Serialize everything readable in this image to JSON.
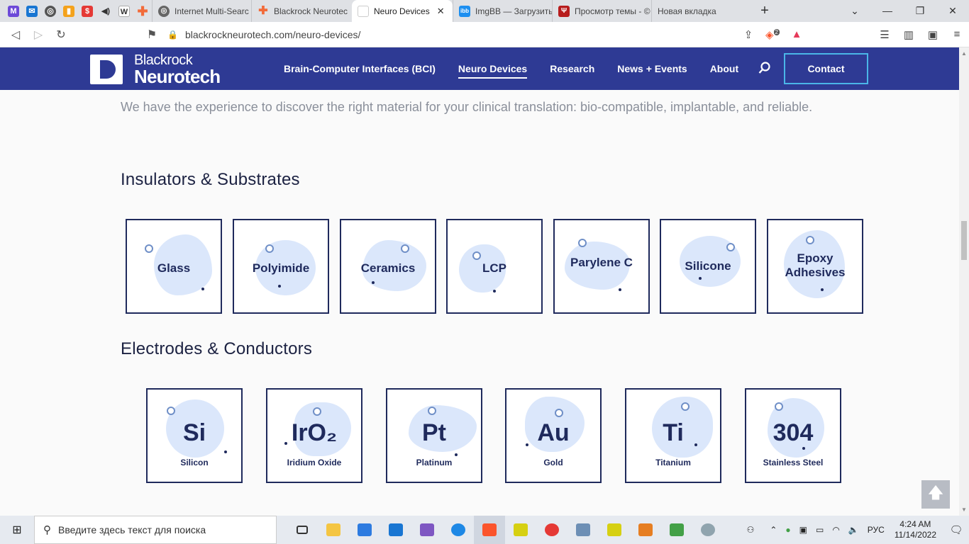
{
  "browser": {
    "pinned_tabs": [
      {
        "icon": "mail-icon",
        "color": "#6d4ad8"
      },
      {
        "icon": "mail-outlook-icon",
        "color": "#1976d2"
      },
      {
        "icon": "globe-icon",
        "color": "#555555"
      },
      {
        "icon": "analytics-icon",
        "color": "#f4a21c"
      },
      {
        "icon": "bank-icon",
        "color": "#e53935"
      },
      {
        "icon": "speaker-icon",
        "color": "#333333"
      },
      {
        "icon": "wikipedia-icon",
        "color": "#333333",
        "glyph": "W"
      },
      {
        "icon": "plus-red-icon",
        "color": "#f26b3a"
      }
    ],
    "tabs": [
      {
        "title": "Internet Multi-Searc",
        "active": false
      },
      {
        "title": "Blackrock Neurotec",
        "active": false
      },
      {
        "title": "Neuro Devices",
        "active": true
      },
      {
        "title": "ImgBB — Загрузить",
        "active": false
      },
      {
        "title": "Просмотр темы - ©",
        "active": false
      },
      {
        "title": "Новая вкладка",
        "active": false
      }
    ],
    "url": "blackrockneurotech.com/neuro-devices/",
    "brave_badge": "2"
  },
  "site": {
    "logo_line1": "Blackrock",
    "logo_line2": "Neurotech",
    "nav": [
      {
        "label": "Brain-Computer Interfaces (BCI)",
        "current": false
      },
      {
        "label": "Neuro Devices",
        "current": true
      },
      {
        "label": "Research",
        "current": false
      },
      {
        "label": "News + Events",
        "current": false
      },
      {
        "label": "About",
        "current": false
      }
    ],
    "contact_label": "Contact",
    "brand_color": "#2e3a94",
    "accent_color": "#4ab6e8"
  },
  "content": {
    "intro": "We have the experience to discover the right material for your clinical translation: bio-compatible, implantable, and reliable.",
    "section1_title": "Insulators & Substrates",
    "section2_title": "Electrodes & Conductors",
    "insulators": [
      {
        "label": "Glass"
      },
      {
        "label": "Polyimide"
      },
      {
        "label": "Ceramics"
      },
      {
        "label": "LCP"
      },
      {
        "label": "Parylene C"
      },
      {
        "label": "Silicone"
      },
      {
        "label": "Epoxy Adhesives"
      }
    ],
    "conductors": [
      {
        "symbol": "Si",
        "name": "Silicon"
      },
      {
        "symbol": "IrO₂",
        "name": "Iridium Oxide"
      },
      {
        "symbol": "Pt",
        "name": "Platinum"
      },
      {
        "symbol": "Au",
        "name": "Gold"
      },
      {
        "symbol": "Ti",
        "name": "Titanium"
      },
      {
        "symbol": "304",
        "name": "Stainless Steel"
      }
    ]
  },
  "taskbar": {
    "search_placeholder": "Введите здесь текст для поиска",
    "language": "РУС",
    "time": "4:24 AM",
    "date": "11/14/2022"
  }
}
